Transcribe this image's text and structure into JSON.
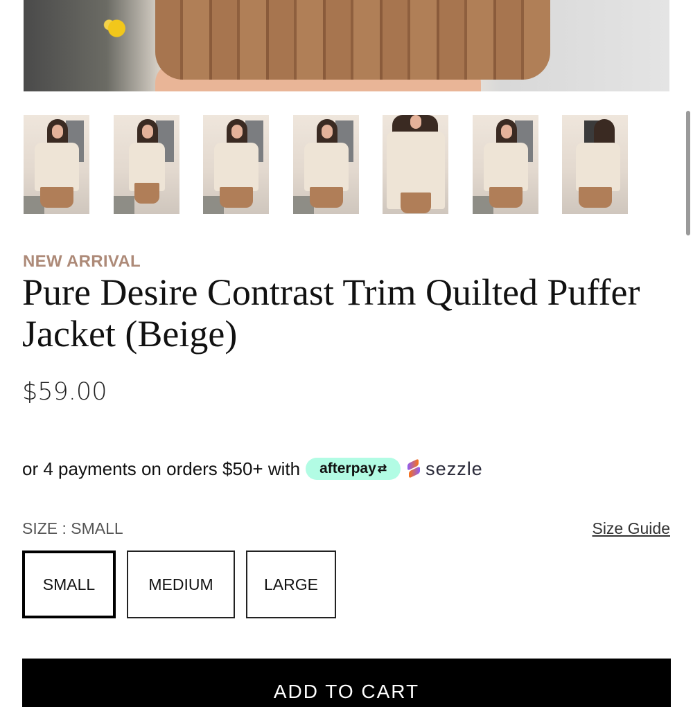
{
  "product": {
    "badge": "NEW ARRIVAL",
    "title": "Pure Desire Contrast Trim Quilted Puffer Jacket (Beige)",
    "price": "$59.00"
  },
  "gallery": {
    "thumbnail_count": 7,
    "selected_thumbnail": 1
  },
  "payments": {
    "text": "or 4 payments on orders $50+ with",
    "afterpay_label": "afterpay",
    "afterpay_color": "#b2fce4",
    "sezzle_label": "sezzle"
  },
  "size": {
    "label": "SIZE : SMALL",
    "guide_label": "Size Guide",
    "options": [
      "SMALL",
      "MEDIUM",
      "LARGE"
    ],
    "selected": "SMALL"
  },
  "cart": {
    "button_label": "ADD TO CART"
  },
  "colors": {
    "badge": "#ad8a78",
    "button": "#000000"
  }
}
